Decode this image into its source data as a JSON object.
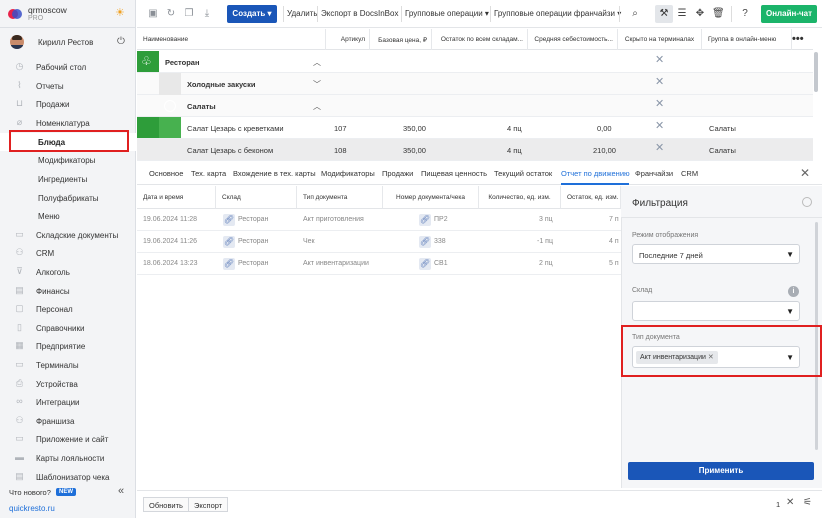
{
  "account": {
    "name": "qrmoscow",
    "plan": "PRO"
  },
  "user": {
    "name": "Кирилл Рестов"
  },
  "sidebar": {
    "items": [
      {
        "label": "Рабочий стол",
        "icon": "dashboard-icon"
      },
      {
        "label": "Отчеты",
        "icon": "chart-icon"
      },
      {
        "label": "Продажи",
        "icon": "cart-icon"
      },
      {
        "label": "Номенклатура",
        "icon": "tag-icon"
      },
      {
        "label": "Блюда",
        "sub": true,
        "active": true
      },
      {
        "label": "Модификаторы",
        "sub": true
      },
      {
        "label": "Ингредиенты",
        "sub": true
      },
      {
        "label": "Полуфабрикаты",
        "sub": true
      },
      {
        "label": "Меню",
        "sub": true
      },
      {
        "label": "Складские документы",
        "icon": "folder-icon"
      },
      {
        "label": "CRM",
        "icon": "people-icon"
      },
      {
        "label": "Алкоголь",
        "icon": "glass-icon"
      },
      {
        "label": "Финансы",
        "icon": "wallet-icon"
      },
      {
        "label": "Персонал",
        "icon": "user-icon"
      },
      {
        "label": "Справочники",
        "icon": "book-icon"
      },
      {
        "label": "Предприятие",
        "icon": "building-icon"
      },
      {
        "label": "Терминалы",
        "icon": "monitor-icon"
      },
      {
        "label": "Устройства",
        "icon": "printer-icon"
      },
      {
        "label": "Интеграции",
        "icon": "link-icon"
      },
      {
        "label": "Франшиза",
        "icon": "network-icon"
      },
      {
        "label": "Приложение и сайт",
        "icon": "app-icon"
      },
      {
        "label": "Карты лояльности",
        "icon": "card-icon"
      },
      {
        "label": "Шаблонизатор чека",
        "icon": "receipt-icon"
      }
    ],
    "whats_new": "Что нового?",
    "new_badge": "NEW",
    "footer_link": "quickresto.ru"
  },
  "toolbar": {
    "create": "Создать",
    "delete": "Удалить",
    "export_docsinbox": "Экспорт в DocsInBox",
    "group_ops": "Групповые операции",
    "franchise_ops": "Групповые операции франчайзи",
    "online_chat": "Онлайн-чат"
  },
  "top_table": {
    "headers": [
      "Наименование",
      "Артикул",
      "Базовая цена, ₽",
      "Остаток по всем складам...",
      "Средняя себестоимость...",
      "Скрыто на терминалах",
      "Группа в онлайн-меню"
    ],
    "rows": [
      {
        "name": "Ресторан",
        "bold": true
      },
      {
        "name": "Холодные закуски",
        "bold": true
      },
      {
        "name": "Салаты",
        "bold": true
      },
      {
        "name": "Салат Цезарь с креветками",
        "article": "107",
        "price": "350,00",
        "stock": "4 пц",
        "cost": "0,00",
        "group": "Салаты"
      },
      {
        "name": "Салат Цезарь с беконом",
        "article": "108",
        "price": "350,00",
        "stock": "4 пц",
        "cost": "210,00",
        "group": "Салаты"
      }
    ]
  },
  "tabs": [
    "Основное",
    "Тех. карта",
    "Вхождение в тех. карты",
    "Модификаторы",
    "Продажи",
    "Пищевая ценность",
    "Текущий остаток",
    "Отчет по движению",
    "Франчайзи",
    "CRM"
  ],
  "movement_table": {
    "headers": [
      "Дата и время",
      "Склад",
      "Тип документа",
      "Номер документа/чека",
      "Количество, ед. изм.",
      "Остаток, ед. изм."
    ],
    "rows": [
      {
        "datetime": "19.06.2024 11:28",
        "warehouse": "Ресторан",
        "doc_type": "Акт приготовления",
        "doc_no": "ПР2",
        "qty": "3 пц",
        "rest": "7 п"
      },
      {
        "datetime": "19.06.2024 11:26",
        "warehouse": "Ресторан",
        "doc_type": "Чек",
        "doc_no": "338",
        "qty": "-1 пц",
        "rest": "4 п"
      },
      {
        "datetime": "18.06.2024 13:23",
        "warehouse": "Ресторан",
        "doc_type": "Акт инвентаризации",
        "doc_no": "СВ1",
        "qty": "2 пц",
        "rest": "5 п"
      }
    ]
  },
  "filter": {
    "title": "Фильтрация",
    "mode_label": "Режим отображения",
    "mode_value": "Последние 7 дней",
    "warehouse_label": "Склад",
    "warehouse_value": "",
    "doctype_label": "Тип документа",
    "doctype_chip": "Акт инвентаризации",
    "apply": "Применить"
  },
  "bottom_bar": {
    "refresh": "Обновить",
    "export": "Экспорт",
    "count": "1"
  },
  "colors": {
    "primary": "#1a56b8",
    "online": "#1bb46a",
    "accent_green": "#2e9d3a",
    "highlight": "#e02020"
  }
}
